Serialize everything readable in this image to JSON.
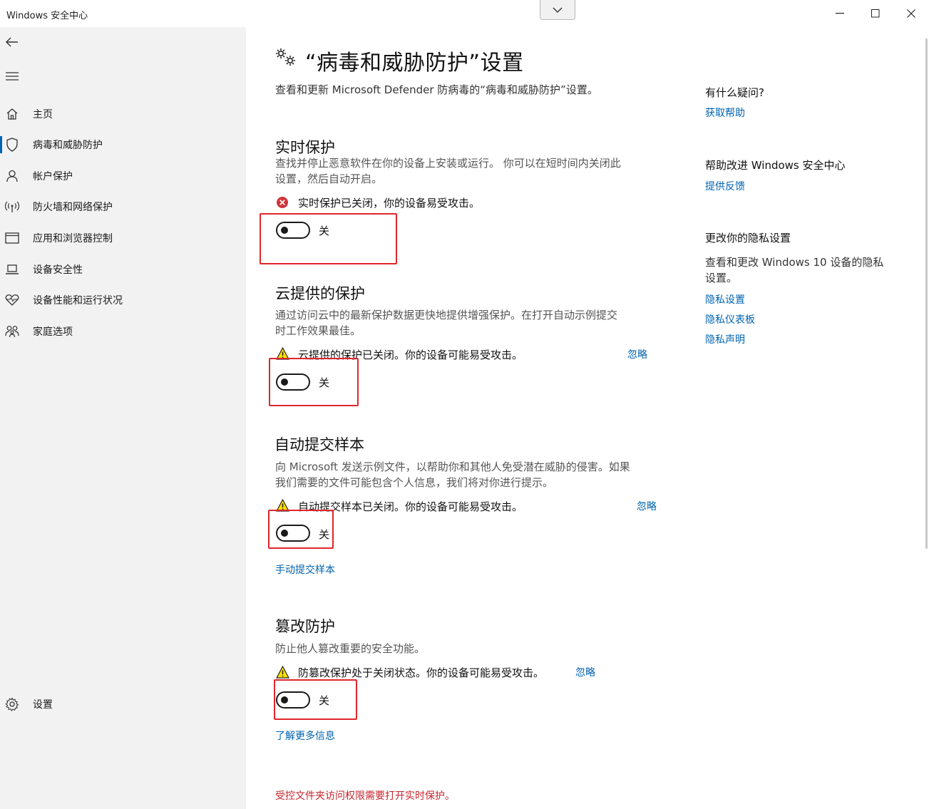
{
  "window": {
    "title": "Windows 安全中心",
    "controls": {
      "minimize": "minimize-icon",
      "maximize": "maximize-icon",
      "close": "close-icon"
    }
  },
  "sidebar": {
    "items": [
      {
        "label": "主页",
        "icon": "home-icon"
      },
      {
        "label": "病毒和威胁防护",
        "icon": "shield-icon",
        "active": true
      },
      {
        "label": "帐户保护",
        "icon": "person-icon"
      },
      {
        "label": "防火墙和网络保护",
        "icon": "wifi-icon"
      },
      {
        "label": "应用和浏览器控制",
        "icon": "browser-window-icon"
      },
      {
        "label": "设备安全性",
        "icon": "laptop-icon"
      },
      {
        "label": "设备性能和运行状况",
        "icon": "heart-pulse-icon"
      },
      {
        "label": "家庭选项",
        "icon": "family-icon"
      }
    ],
    "settings_label": "设置"
  },
  "main": {
    "title": "“病毒和威胁防护”设置",
    "subtitle": "查看和更新 Microsoft Defender 防病毒的“病毒和威胁防护”设置。",
    "sections": [
      {
        "title": "实时保护",
        "desc_line1": "查找并停止恶意软件在你的设备上安装或运行。 你可以在短时间内关闭此",
        "desc_line2": "设置，然后自动开启。",
        "status": "实时保护已关闭，你的设备易受攻击。",
        "status_icon": "error-x-icon",
        "toggle_label": "关"
      },
      {
        "title": "云提供的保护",
        "desc_line1": "通过访问云中的最新保护数据更快地提供增强保护。在打开自动示例提交",
        "desc_line2": "时工作效果最佳。",
        "status": "云提供的保护已关闭。你的设备可能易受攻击。",
        "status_icon": "warning-icon",
        "dismiss": "忽略",
        "toggle_label": "关"
      },
      {
        "title": "自动提交样本",
        "desc_line1": "向 Microsoft 发送示例文件，以帮助你和其他人免受潜在威胁的侵害。如果",
        "desc_line2": "我们需要的文件可能包含个人信息，我们将对你进行提示。",
        "status": "自动提交样本已关闭。你的设备可能易受攻击。",
        "status_icon": "warning-icon",
        "dismiss": "忽略",
        "toggle_label": "关",
        "link": "手动提交样本"
      },
      {
        "title": "篡改防护",
        "desc_line1": "防止他人篡改重要的安全功能。",
        "status": "防篡改保护处于关闭状态。你的设备可能易受攻击。",
        "status_icon": "warning-icon",
        "dismiss": "忽略",
        "toggle_label": "关",
        "link": "了解更多信息"
      }
    ],
    "footer_warning": "受控文件夹访问权限需要打开实时保护。"
  },
  "right_panel": {
    "question_title": "有什么疑问?",
    "get_help": "获取帮助",
    "improve_title": "帮助改进 Windows 安全中心",
    "feedback": "提供反馈",
    "privacy_title": "更改你的隐私设置",
    "privacy_desc_line1": "查看和更改 Windows 10 设备的隐私",
    "privacy_desc_line2": "设置。",
    "privacy_links": [
      "隐私设置",
      "隐私仪表板",
      "隐私声明"
    ]
  },
  "colors": {
    "accent": "#0063b1",
    "error": "#c4262e",
    "highlight": "#e0262b",
    "sidebar_bg": "#f2f2f2"
  }
}
